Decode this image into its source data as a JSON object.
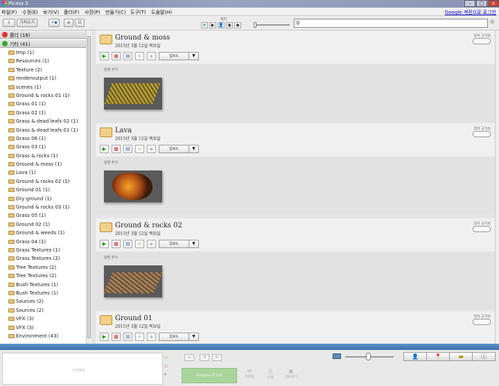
{
  "window": {
    "title": "Picasa 3"
  },
  "menu": {
    "items": [
      "파일(F)",
      "수정(E)",
      "보기(V)",
      "폴더(F)",
      "사진(P)",
      "만들기(C)",
      "도구(T)",
      "도움말(H)"
    ],
    "login": "Google 계정으로 로그인"
  },
  "toolbar": {
    "import_label": "가져오기",
    "filter_label": "필터",
    "filter_icons": [
      "★",
      "▶",
      "👤",
      "◉",
      "◆"
    ]
  },
  "sidebar": {
    "sections": [
      {
        "label": "폴더 (18)",
        "color": "#d33"
      },
      {
        "label": "기타 (41)",
        "color": "#3a3"
      }
    ],
    "folders": [
      "tmp (1)",
      "Resources (1)",
      "Texture (2)",
      "renderoutput (1)",
      "scenes (1)",
      "Ground & rocks 01 (1)",
      "Grass 01 (1)",
      "Grass 02 (1)",
      "Grass & dead leafs 02 (1)",
      "Grass & dead leafs 01 (1)",
      "Grass 06 (1)",
      "Grass 03 (1)",
      "Grass & rocks (1)",
      "Ground & moss (1)",
      "Lava (1)",
      "Ground & rocks 02 (1)",
      "Ground 01 (1)",
      "Dry ground (1)",
      "Ground & rocks 03 (1)",
      "Grass 05 (1)",
      "Ground 02 (1)",
      "Ground & weeds (1)",
      "Grass 04 (1)",
      "Grass Textures (1)",
      "Grass Textures (2)",
      "Tree Textures (2)",
      "Tree Textures (2)",
      "Bush Textures (1)",
      "Bush Textures (1)",
      "Sources (2)",
      "Sources (2)",
      "VFX (3)",
      "VFX (3)",
      "Environment (43)"
    ]
  },
  "albums": [
    {
      "title": "Ground & moss",
      "date": "2015년 3월 12일 목요일",
      "share": "웹에 공개됨",
      "caption": "설명 추가",
      "upload": "업로드",
      "texture": "moss"
    },
    {
      "title": "Lava",
      "date": "2015년 3월 12일 목요일",
      "share": "웹에 공개됨",
      "caption": "설명 추가",
      "upload": "업로드",
      "texture": "lava"
    },
    {
      "title": "Ground & rocks 02",
      "date": "2015년 3월 12일 목요일",
      "share": "웹에 공개됨",
      "caption": "설명 추가",
      "upload": "업로드",
      "texture": "rocks"
    },
    {
      "title": "Ground 01",
      "date": "2015년 3월 12일 목요일",
      "share": "웹에 공개됨",
      "caption": "설명 추가",
      "upload": "업로드",
      "texture": "none"
    }
  ],
  "tray": {
    "selection_text": "선택항목",
    "share_button": "Google+에 공유",
    "actions": [
      "이메일",
      "인쇄",
      "내보내기"
    ],
    "right_icons": [
      "person-icon",
      "pin-icon",
      "folder-icon",
      "info-icon"
    ]
  }
}
